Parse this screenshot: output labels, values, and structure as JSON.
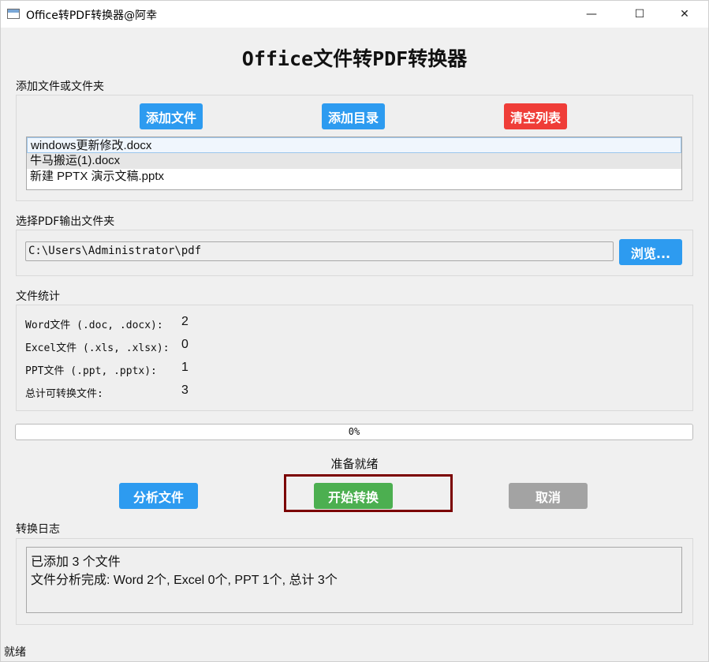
{
  "window": {
    "title": "Office转PDF转换器@阿幸",
    "minimize_glyph": "—",
    "maximize_glyph": "☐",
    "close_glyph": "✕"
  },
  "heading": "Office文件转PDF转换器",
  "add_section": {
    "label": "添加文件或文件夹",
    "add_file_button": "添加文件",
    "add_dir_button": "添加目录",
    "clear_button": "清空列表",
    "files": [
      "windows更新修改.docx",
      "牛马搬运(1).docx",
      "新建 PPTX 演示文稿.pptx"
    ]
  },
  "output_section": {
    "label": "选择PDF输出文件夹",
    "path_value": "C:\\Users\\Administrator\\pdf",
    "browse_button": "浏览..."
  },
  "stats_section": {
    "label": "文件统计",
    "rows": [
      {
        "label": "Word文件 (.doc, .docx):",
        "value": "2"
      },
      {
        "label": "Excel文件 (.xls, .xlsx):",
        "value": "0"
      },
      {
        "label": "PPT文件 (.ppt, .pptx):",
        "value": "1"
      },
      {
        "label": "总计可转换文件:",
        "value": "3"
      }
    ]
  },
  "progress": {
    "value": 0,
    "text": "0%"
  },
  "status": "准备就绪",
  "actions": {
    "analyze_button": "分析文件",
    "start_button": "开始转换",
    "cancel_button": "取消"
  },
  "log_section": {
    "label": "转换日志",
    "lines": [
      "已添加 3 个文件",
      "文件分析完成: Word 2个, Excel 0个, PPT 1个, 总计 3个"
    ]
  },
  "statusbar": "就绪",
  "colors": {
    "blue_button": "#2d9bf0",
    "red_button": "#ef3d38",
    "green_button": "#4caf50",
    "gray_button": "#a3a3a3",
    "highlight_border": "#7b0000"
  }
}
